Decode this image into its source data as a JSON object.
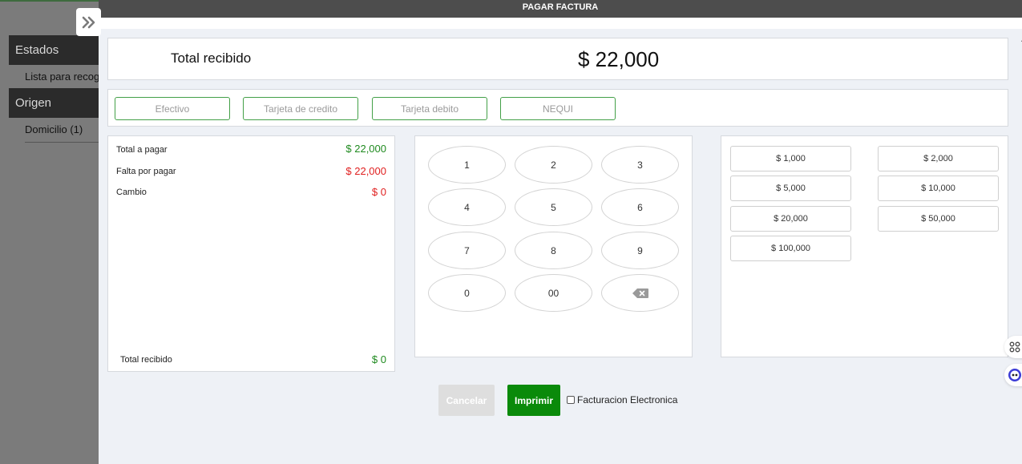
{
  "sidebar": {
    "sections": [
      {
        "title": "Estados",
        "items": [
          "Lista para recoger"
        ]
      },
      {
        "title": "Origen",
        "items": [
          "Domicilio (1)"
        ]
      }
    ]
  },
  "modal": {
    "title": "PAGAR FACTURA",
    "total_label": "Total recibido",
    "total_amount": "$ 22,000",
    "payment_methods": [
      "Efectivo",
      "Tarjeta de credito",
      "Tarjeta debito",
      "NEQUI"
    ],
    "summary": {
      "rows": [
        {
          "label": "Total a pagar",
          "value": "$ 22,000",
          "color": "#1f8a1f"
        },
        {
          "label": "Falta por pagar",
          "value": "$ 22,000",
          "color": "#e02020"
        },
        {
          "label": "Cambio",
          "value": "$ 0",
          "color": "#e02020"
        }
      ],
      "footer_label": "Total recibido",
      "footer_value": "$ 0"
    },
    "keypad": {
      "keys": [
        "1",
        "2",
        "3",
        "4",
        "5",
        "6",
        "7",
        "8",
        "9",
        "0",
        "00"
      ],
      "backspace_icon": "backspace-icon"
    },
    "quick_amounts": [
      "$ 1,000",
      "$ 2,000",
      "$ 5,000",
      "$ 10,000",
      "$ 20,000",
      "$ 50,000",
      "$ 100,000"
    ],
    "actions": {
      "cancel_label": "Cancelar",
      "print_label": "Imprimir",
      "einvoice_label": "Facturacion Electronica",
      "einvoice_checked": false
    }
  },
  "colors": {
    "accent_green": "#0a8a0a",
    "method_border": "#43a047",
    "header_bg": "#4d4d4d"
  }
}
